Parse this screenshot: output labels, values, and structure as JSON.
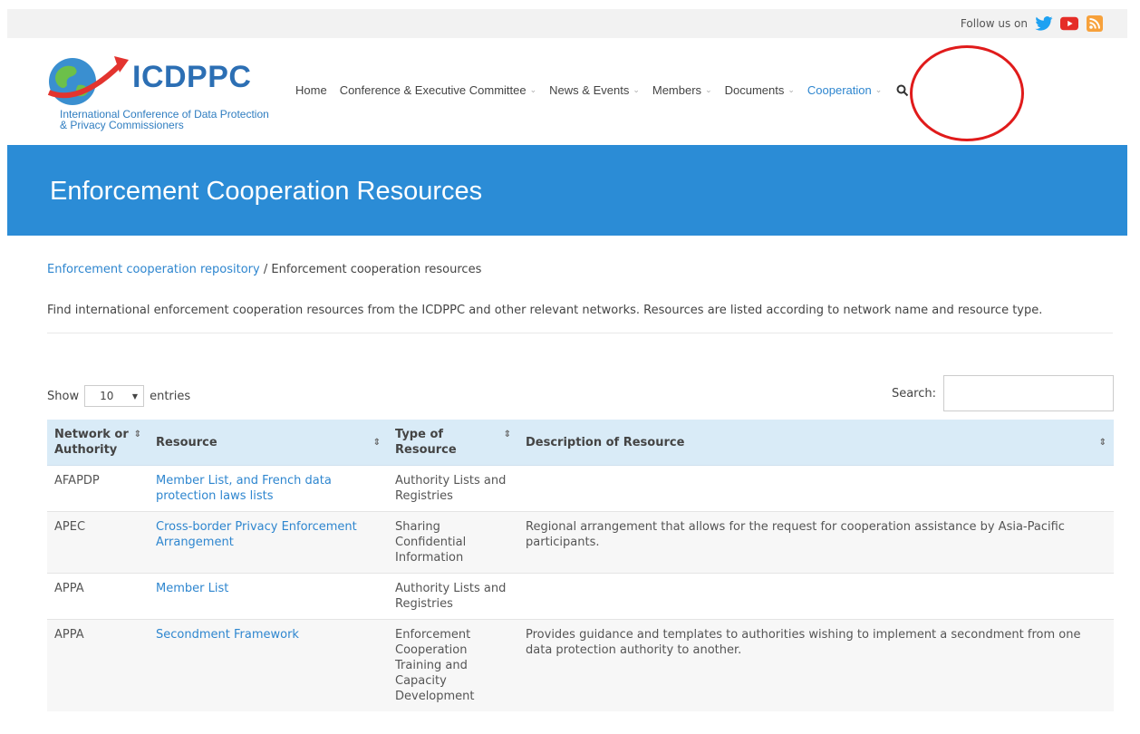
{
  "topbar": {
    "follow_text": "Follow us on",
    "icons": [
      "twitter-icon",
      "youtube-icon",
      "rss-icon"
    ]
  },
  "logo": {
    "title": "ICDPPC",
    "subtitle": "International Conference of Data Protection & Privacy Commissioners"
  },
  "nav": {
    "items": [
      {
        "label": "Home",
        "dropdown": false
      },
      {
        "label": "Conference & Executive Committee",
        "dropdown": true
      },
      {
        "label": "News & Events",
        "dropdown": true
      },
      {
        "label": "Members",
        "dropdown": true
      },
      {
        "label": "Documents",
        "dropdown": true
      },
      {
        "label": "Cooperation",
        "dropdown": true,
        "active": true
      }
    ],
    "search_icon": "search-icon"
  },
  "banner": {
    "title": "Enforcement Cooperation Resources"
  },
  "breadcrumb": {
    "link": "Enforcement cooperation repository",
    "separator": " / ",
    "current": "Enforcement cooperation resources"
  },
  "description": "Find international enforcement cooperation resources from the ICDPPC and other relevant networks. Resources are listed according to network name and resource type.",
  "controls": {
    "show_label": "Show",
    "entries_value": "10",
    "entries_label": "entries",
    "search_label": "Search:"
  },
  "table": {
    "headers": [
      "Network or Authority",
      "Resource",
      "Type of Resource",
      "Description of Resource"
    ],
    "rows": [
      {
        "network": "AFAPDP",
        "resource": "Member List, and French data protection laws lists",
        "type": "Authority Lists and Registries",
        "description": ""
      },
      {
        "network": "APEC",
        "resource": "Cross-border Privacy Enforcement Arrangement",
        "type": "Sharing Confidential Information",
        "description": "Regional arrangement that allows for the request for cooperation assistance by Asia-Pacific participants."
      },
      {
        "network": "APPA",
        "resource": "Member List",
        "type": "Authority Lists and Registries",
        "description": ""
      },
      {
        "network": "APPA",
        "resource": "Secondment Framework",
        "type": "Enforcement Cooperation Training and Capacity Development",
        "description": "Provides guidance and templates to authorities wishing to implement a secondment from one data protection authority to another."
      }
    ]
  },
  "colors": {
    "brand": "#2b8cd6",
    "link": "#2e86cf",
    "header_row": "#d9ebf7",
    "highlight_circle": "#e01b1b"
  }
}
